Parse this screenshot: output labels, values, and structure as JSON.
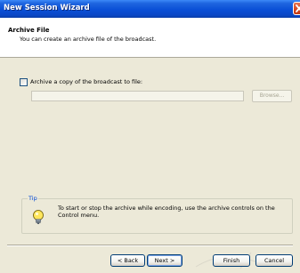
{
  "window": {
    "title": "New Session Wizard"
  },
  "header": {
    "title": "Archive File",
    "subtitle": "You can create an archive file of the broadcast."
  },
  "archive": {
    "checkbox_label": "Archive a copy of the broadcast to file:",
    "checked": false,
    "path_value": "",
    "browse_label": "Browse..."
  },
  "tip": {
    "legend": "Tip",
    "text": "To start or stop the archive while encoding, use the archive controls on the Control menu.",
    "icon": "lightbulb-icon"
  },
  "footer": {
    "back_label": "< Back",
    "next_label": "Next >",
    "finish_label": "Finish",
    "cancel_label": "Cancel"
  },
  "colors": {
    "titlebar": "#0a4fd6",
    "dialog_bg": "#ece9d8",
    "tip_legend": "#0046d5",
    "close_button": "#d54620"
  }
}
